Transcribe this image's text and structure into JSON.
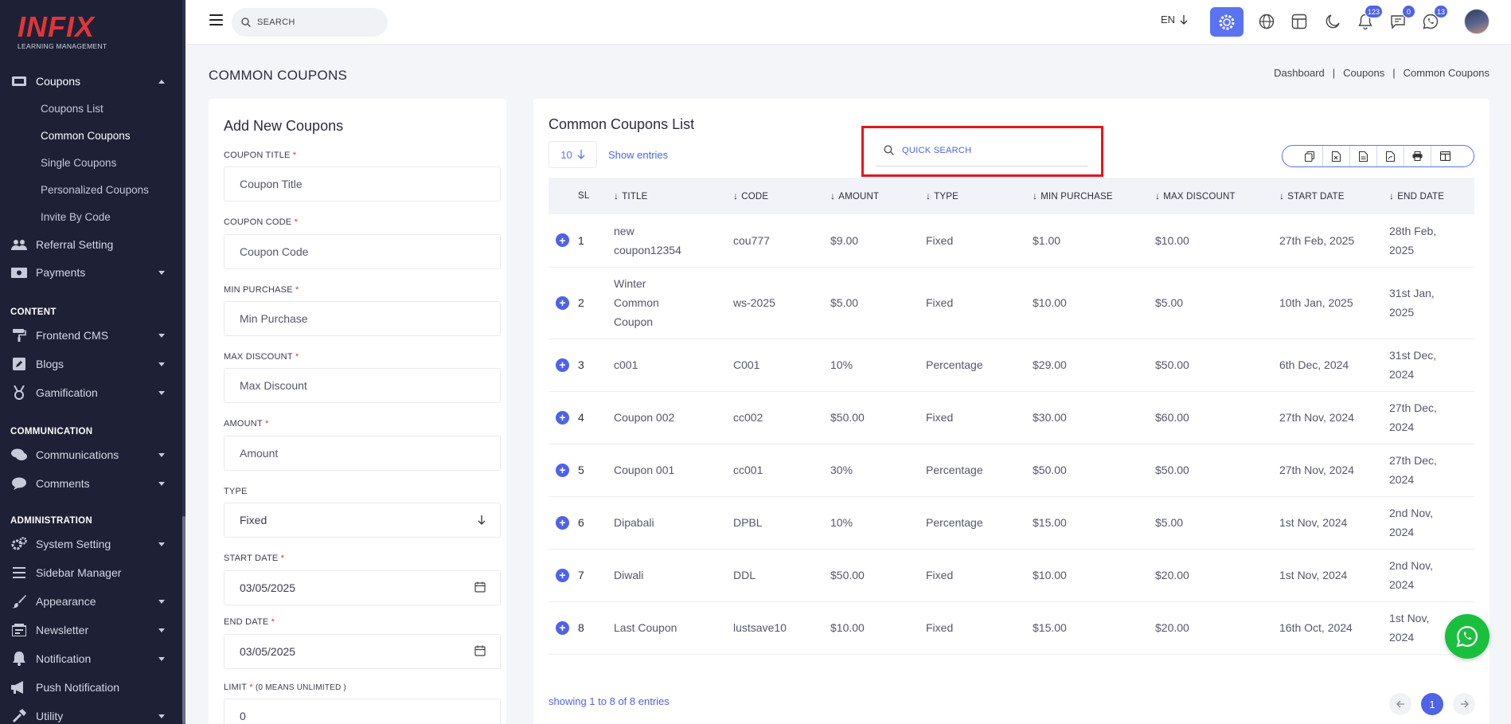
{
  "logo": {
    "mark": "INFIX",
    "sub": "LEARNING MANAGEMENT"
  },
  "sidebar": {
    "coupons": {
      "label": "Coupons",
      "icon": "ticket-icon"
    },
    "coupon_sub": [
      {
        "label": "Coupons List"
      },
      {
        "label": "Common Coupons",
        "active": true
      },
      {
        "label": "Single Coupons"
      },
      {
        "label": "Personalized Coupons"
      },
      {
        "label": "Invite By Code"
      }
    ],
    "referral": "Referral Setting",
    "payments": "Payments",
    "section_content": "CONTENT",
    "frontend_cms": "Frontend CMS",
    "blogs": "Blogs",
    "gamification": "Gamification",
    "section_communication": "COMMUNICATION",
    "communications": "Communications",
    "comments": "Comments",
    "section_administration": "ADMINISTRATION",
    "system_setting": "System Setting",
    "sidebar_manager": "Sidebar Manager",
    "appearance": "Appearance",
    "newsletter": "Newsletter",
    "notification": "Notification",
    "push_notification": "Push Notification",
    "utility": "Utility"
  },
  "topbar": {
    "search_placeholder": "SEARCH",
    "language": "EN",
    "badges": {
      "notifications": "123",
      "messages": "0",
      "whatsapp": "13"
    }
  },
  "page": {
    "title": "COMMON COUPONS",
    "breadcrumb": [
      "Dashboard",
      "Coupons",
      "Common Coupons"
    ]
  },
  "form": {
    "title": "Add New Coupons",
    "coupon_title": {
      "label": "COUPON TITLE",
      "placeholder": "Coupon Title"
    },
    "coupon_code": {
      "label": "COUPON CODE",
      "placeholder": "Coupon Code"
    },
    "min_purchase": {
      "label": "MIN PURCHASE",
      "placeholder": "Min Purchase"
    },
    "max_discount": {
      "label": "MAX DISCOUNT",
      "placeholder": "Max Discount"
    },
    "amount": {
      "label": "AMOUNT",
      "placeholder": "Amount"
    },
    "type": {
      "label": "TYPE",
      "value": "Fixed"
    },
    "start_date": {
      "label": "START DATE",
      "value": "03/05/2025"
    },
    "end_date": {
      "label": "END DATE",
      "value": "03/05/2025"
    },
    "limit": {
      "label": "LIMIT",
      "hint": "(0 MEANS UNLIMITED )",
      "value": "0"
    },
    "required_mark": "*"
  },
  "list": {
    "title": "Common Coupons List",
    "page_size": "10",
    "show_entries": "Show entries",
    "quick_search_placeholder": "QUICK SEARCH",
    "columns": [
      "SL",
      "TITLE",
      "CODE",
      "AMOUNT",
      "TYPE",
      "MIN PURCHASE",
      "MAX DISCOUNT",
      "START DATE",
      "END DATE"
    ],
    "rows": [
      {
        "sl": "1",
        "title": "new coupon12354",
        "code": "cou777",
        "amount": "$9.00",
        "type": "Fixed",
        "min": "$1.00",
        "max": "$10.00",
        "start": "27th Feb, 2025",
        "end": "28th Feb, 2025"
      },
      {
        "sl": "2",
        "title": "Winter Common Coupon",
        "code": "ws-2025",
        "amount": "$5.00",
        "type": "Fixed",
        "min": "$10.00",
        "max": "$5.00",
        "start": "10th Jan, 2025",
        "end": "31st Jan, 2025"
      },
      {
        "sl": "3",
        "title": "c001",
        "code": "C001",
        "amount": "10%",
        "type": "Percentage",
        "min": "$29.00",
        "max": "$50.00",
        "start": "6th Dec, 2024",
        "end": "31st Dec, 2024"
      },
      {
        "sl": "4",
        "title": "Coupon 002",
        "code": "cc002",
        "amount": "$50.00",
        "type": "Fixed",
        "min": "$30.00",
        "max": "$60.00",
        "start": "27th Nov, 2024",
        "end": "27th Dec, 2024"
      },
      {
        "sl": "5",
        "title": "Coupon 001",
        "code": "cc001",
        "amount": "30%",
        "type": "Percentage",
        "min": "$50.00",
        "max": "$50.00",
        "start": "27th Nov, 2024",
        "end": "27th Dec, 2024"
      },
      {
        "sl": "6",
        "title": "Dipabali",
        "code": "DPBL",
        "amount": "10%",
        "type": "Percentage",
        "min": "$15.00",
        "max": "$5.00",
        "start": "1st Nov, 2024",
        "end": "2nd Nov, 2024"
      },
      {
        "sl": "7",
        "title": "Diwali",
        "code": "DDL",
        "amount": "$50.00",
        "type": "Fixed",
        "min": "$10.00",
        "max": "$20.00",
        "start": "1st Nov, 2024",
        "end": "2nd Nov, 2024"
      },
      {
        "sl": "8",
        "title": "Last Coupon",
        "code": "lustsave10",
        "amount": "$10.00",
        "type": "Fixed",
        "min": "$15.00",
        "max": "$20.00",
        "start": "16th Oct, 2024",
        "end": "1st Nov, 2024"
      }
    ],
    "showing": "showing 1 to 8 of 8 entries",
    "current_page": "1"
  },
  "colors": {
    "accent": "#5a73f2",
    "sidebar": "#1e2135",
    "highlight": "#e8141b",
    "whatsapp": "#1bbf3e"
  }
}
